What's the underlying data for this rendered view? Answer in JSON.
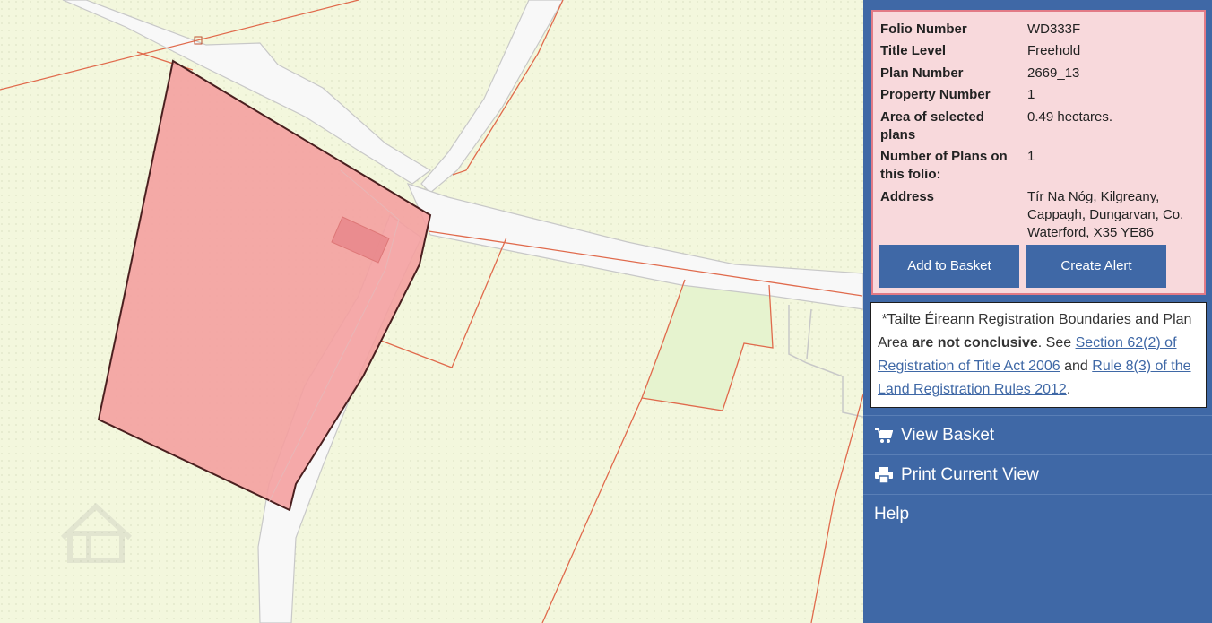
{
  "folio": {
    "rows": [
      {
        "label": "Folio Number",
        "value": "WD333F"
      },
      {
        "label": "Title Level",
        "value": "Freehold"
      },
      {
        "label": "Plan Number",
        "value": "2669_13"
      },
      {
        "label": "Property Number",
        "value": "1"
      },
      {
        "label": "Area of selected plans",
        "value": "0.49 hectares."
      },
      {
        "label": "Number of Plans on this folio:",
        "value": "1"
      },
      {
        "label": "Address",
        "value": "Tír Na Nóg, Kilgreany, Cappagh, Dungarvan, Co. Waterford, X35 YE86"
      }
    ],
    "add_basket_label": "Add to Basket",
    "create_alert_label": "Create Alert"
  },
  "notice": {
    "prefix": "*Tailte Éireann Registration Boundaries and Plan Area ",
    "bold": "are not conclusive",
    "mid": ". See ",
    "link1": "Section 62(2) of Registration of Title Act 2006",
    "and": " and ",
    "link2": "Rule 8(3) of the Land Registration Rules 2012",
    "end": "."
  },
  "menu": {
    "view_basket": "View Basket",
    "print_view": "Print Current View",
    "help": "Help",
    "view_basket_icon": "cart-icon",
    "print_icon": "printer-icon"
  },
  "colors": {
    "panel_bg": "#3f68a6",
    "card_bg": "#f8d9dc",
    "card_border": "#e27a86",
    "parcel_fill": "#f4a0a0",
    "map_bg": "#f3f7dd"
  }
}
